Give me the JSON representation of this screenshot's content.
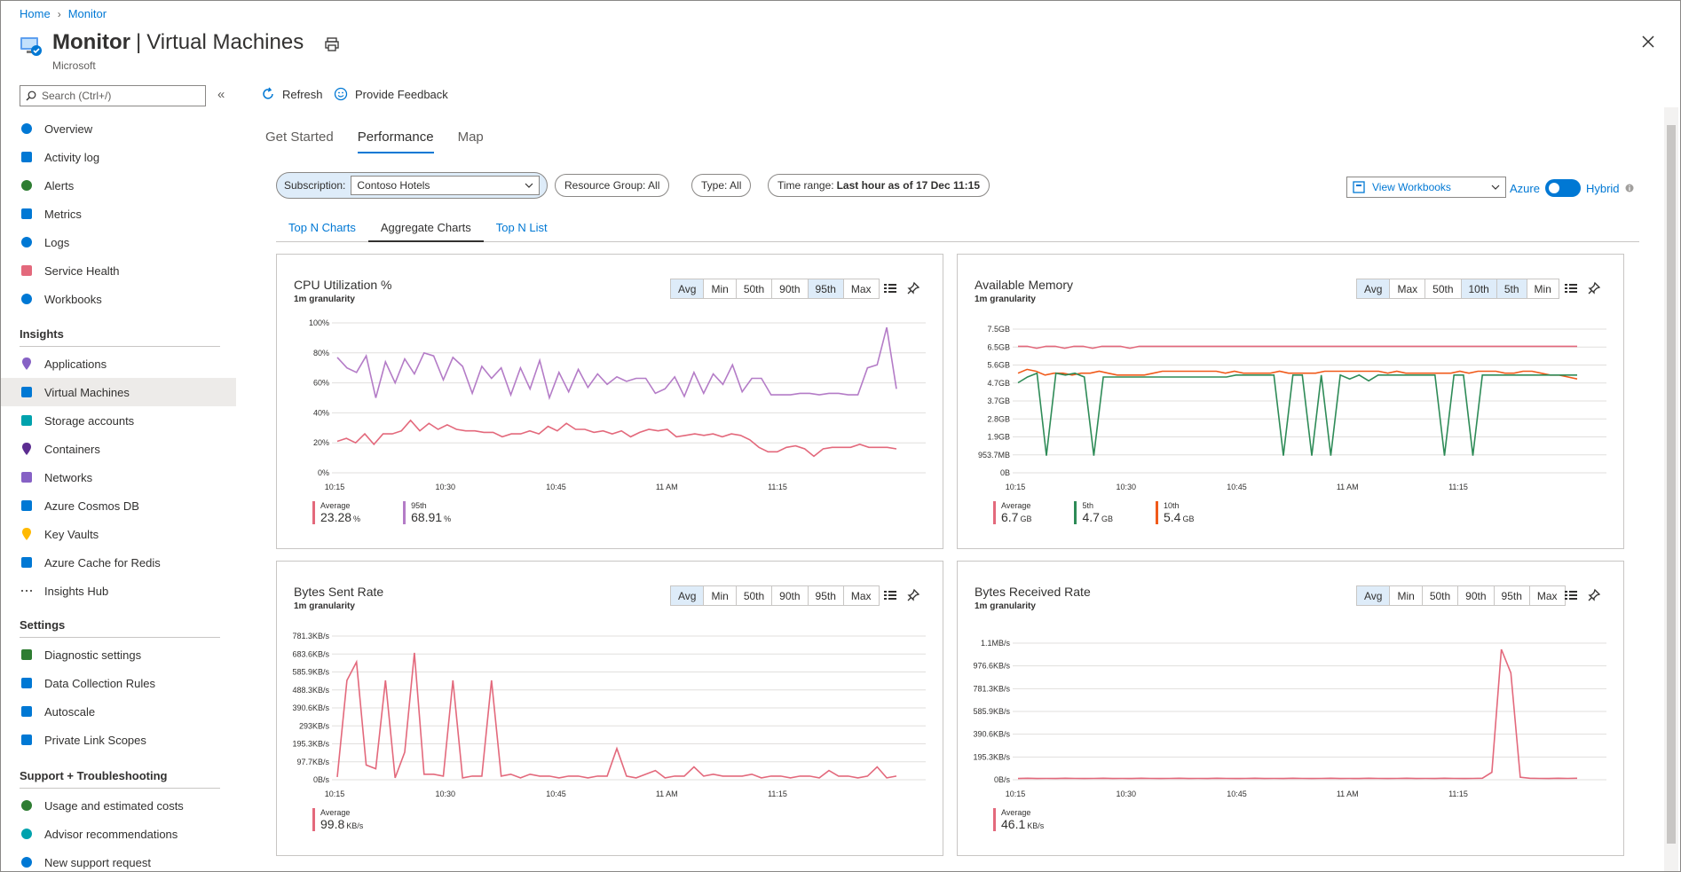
{
  "breadcrumb": [
    "Home",
    "Monitor"
  ],
  "header": {
    "title_bold": "Monitor",
    "title_rest": "Virtual Machines",
    "subtitle": "Microsoft"
  },
  "search": {
    "placeholder": "Search (Ctrl+/)"
  },
  "sidebar": {
    "top_items": [
      "Overview",
      "Activity log",
      "Alerts",
      "Metrics",
      "Logs",
      "Service Health",
      "Workbooks"
    ],
    "insights_header": "Insights",
    "insights_items": [
      "Applications",
      "Virtual Machines",
      "Storage accounts",
      "Containers",
      "Networks",
      "Azure Cosmos DB",
      "Key Vaults",
      "Azure Cache for Redis",
      "Insights Hub"
    ],
    "settings_header": "Settings",
    "settings_items": [
      "Diagnostic settings",
      "Data Collection Rules",
      "Autoscale",
      "Private Link Scopes"
    ],
    "support_header": "Support + Troubleshooting",
    "support_items": [
      "Usage and estimated costs",
      "Advisor recommendations",
      "New support request"
    ]
  },
  "toolbar": {
    "refresh": "Refresh",
    "feedback": "Provide Feedback"
  },
  "tabs": [
    "Get Started",
    "Performance",
    "Map"
  ],
  "filters": {
    "subscription_label": "Subscription:",
    "subscription_value": "Contoso Hotels",
    "resource_group": "Resource Group: All",
    "type": "Type: All",
    "time_range_label": "Time range: ",
    "time_range_value": "Last hour as of 17 Dec 11:15",
    "view_workbooks": "View Workbooks",
    "azure": "Azure",
    "hybrid": "Hybrid"
  },
  "subtabs": [
    "Top N Charts",
    "Aggregate Charts",
    "Top N List"
  ],
  "colors": {
    "accent": "#0078d4",
    "avg": "#e3697c",
    "p95": "#b47cc7",
    "p5": "#2e8b57",
    "p10": "#f05a1a"
  },
  "cards": [
    {
      "title": "CPU Utilization %",
      "granularity": "1m granularity",
      "buttons": [
        "Avg",
        "Min",
        "50th",
        "90th",
        "95th",
        "Max"
      ],
      "selected": [
        "Avg",
        "95th"
      ],
      "legend": [
        {
          "name": "Average",
          "value": "23.28",
          "unit": "%"
        },
        {
          "name": "95th",
          "value": "68.91",
          "unit": "%"
        }
      ]
    },
    {
      "title": "Available Memory",
      "granularity": "1m granularity",
      "buttons": [
        "Avg",
        "Max",
        "50th",
        "10th",
        "5th",
        "Min"
      ],
      "selected": [
        "Avg",
        "10th",
        "5th"
      ],
      "legend": [
        {
          "name": "Average",
          "value": "6.7",
          "unit": "GB"
        },
        {
          "name": "5th",
          "value": "4.7",
          "unit": "GB"
        },
        {
          "name": "10th",
          "value": "5.4",
          "unit": "GB"
        }
      ]
    },
    {
      "title": "Bytes Sent Rate",
      "granularity": "1m granularity",
      "buttons": [
        "Avg",
        "Min",
        "50th",
        "90th",
        "95th",
        "Max"
      ],
      "selected": [
        "Avg"
      ],
      "legend": [
        {
          "name": "Average",
          "value": "99.8",
          "unit": "KB/s"
        }
      ]
    },
    {
      "title": "Bytes Received Rate",
      "granularity": "1m granularity",
      "buttons": [
        "Avg",
        "Min",
        "50th",
        "90th",
        "95th",
        "Max"
      ],
      "selected": [
        "Avg"
      ],
      "legend": [
        {
          "name": "Average",
          "value": "46.1",
          "unit": "KB/s"
        }
      ]
    }
  ],
  "chart_data": [
    {
      "type": "line",
      "title": "CPU Utilization %",
      "x_ticks": [
        "10:15",
        "10:30",
        "10:45",
        "11 AM",
        "11:15"
      ],
      "y_ticks": [
        "100%",
        "80%",
        "60%",
        "40%",
        "20%",
        "0%"
      ],
      "ylim": [
        0,
        100
      ],
      "series": [
        {
          "name": "95th",
          "color": "#b47cc7",
          "values": [
            77,
            70,
            67,
            78,
            50,
            74,
            60,
            76,
            66,
            80,
            78,
            62,
            77,
            71,
            53,
            71,
            63,
            70,
            52,
            70,
            56,
            75,
            50,
            67,
            54,
            69,
            57,
            66,
            59,
            64,
            61,
            63,
            63,
            53,
            56,
            64,
            51,
            67,
            53,
            66,
            59,
            72,
            54,
            63,
            63,
            52,
            52,
            52,
            53,
            53,
            52,
            53,
            53,
            52,
            52,
            70,
            72,
            97,
            56
          ]
        },
        {
          "name": "Average",
          "color": "#e3697c",
          "values": [
            21,
            23,
            20,
            26,
            19,
            26,
            26,
            28,
            35,
            28,
            33,
            29,
            32,
            29,
            28,
            28,
            27,
            27,
            24,
            26,
            26,
            28,
            26,
            31,
            28,
            33,
            29,
            29,
            27,
            28,
            26,
            28,
            24,
            27,
            29,
            28,
            29,
            24,
            25,
            26,
            25,
            26,
            24,
            26,
            25,
            22,
            17,
            14,
            14,
            17,
            18,
            16,
            11,
            16,
            17,
            17,
            17,
            19,
            17,
            17,
            17,
            16
          ]
        }
      ]
    },
    {
      "type": "line",
      "title": "Available Memory",
      "x_ticks": [
        "10:15",
        "10:30",
        "10:45",
        "11 AM",
        "11:15"
      ],
      "y_ticks": [
        "7.5GB",
        "6.5GB",
        "5.6GB",
        "4.7GB",
        "3.7GB",
        "2.8GB",
        "1.9GB",
        "953.7MB",
        "0B"
      ],
      "ylim": [
        0,
        7.5
      ],
      "series": [
        {
          "name": "Average",
          "color": "#e3697c",
          "values": [
            6.6,
            6.6,
            6.5,
            6.6,
            6.6,
            6.5,
            6.6,
            6.6,
            6.5,
            6.6,
            6.6,
            6.6,
            6.5,
            6.6,
            6.6,
            6.6,
            6.6,
            6.6,
            6.6,
            6.6,
            6.6,
            6.6,
            6.6,
            6.6,
            6.6,
            6.6,
            6.6,
            6.6,
            6.6,
            6.6,
            6.6,
            6.6,
            6.6,
            6.6,
            6.6,
            6.6,
            6.6,
            6.6,
            6.6,
            6.6,
            6.6,
            6.6,
            6.6,
            6.6,
            6.6,
            6.6,
            6.6,
            6.6,
            6.6,
            6.6,
            6.6,
            6.6,
            6.6,
            6.6,
            6.6,
            6.6,
            6.6,
            6.6,
            6.6,
            6.6,
            6.6
          ]
        },
        {
          "name": "10th",
          "color": "#f05a1a",
          "values": [
            5.2,
            5.4,
            5.3,
            5.1,
            5.2,
            5.2,
            5.1,
            5.2,
            5.2,
            5.3,
            5.2,
            5.1,
            5.1,
            5.1,
            5.1,
            5.2,
            5.3,
            5.3,
            5.3,
            5.3,
            5.3,
            5.3,
            5.3,
            5.2,
            5.3,
            5.2,
            5.2,
            5.2,
            5.2,
            5.3,
            5.2,
            5.2,
            5.2,
            5.2,
            5.3,
            5.3,
            5.3,
            5.3,
            5.3,
            5.3,
            5.3,
            5.2,
            5.3,
            5.2,
            5.2,
            5.2,
            5.2,
            5.2,
            5.2,
            5.3,
            5.2,
            5.3,
            5.3,
            5.3,
            5.2,
            5.2,
            5.3,
            5.3,
            5.2,
            5.1,
            5.1,
            5.0,
            4.9
          ]
        },
        {
          "name": "5th",
          "color": "#2e8b57",
          "values": [
            4.7,
            5.0,
            5.2,
            0.9,
            5.2,
            5.1,
            5.2,
            5.0,
            0.9,
            5.0,
            5.0,
            5.0,
            5.0,
            5.0,
            5.0,
            5.0,
            5.0,
            5.0,
            5.0,
            5.0,
            5.0,
            5.0,
            5.0,
            5.1,
            5.1,
            5.1,
            5.1,
            5.1,
            0.9,
            5.1,
            5.1,
            0.9,
            5.1,
            0.9,
            5.1,
            4.9,
            5.1,
            4.8,
            5.1,
            5.1,
            5.1,
            5.1,
            5.1,
            5.1,
            5.1,
            0.9,
            5.1,
            5.1,
            0.9,
            5.1,
            5.1,
            5.1,
            5.1,
            5.1,
            5.1,
            5.1,
            5.1,
            5.1,
            5.1,
            5.1
          ]
        }
      ]
    },
    {
      "type": "line",
      "title": "Bytes Sent Rate",
      "x_ticks": [
        "10:15",
        "10:30",
        "10:45",
        "11 AM",
        "11:15"
      ],
      "y_ticks": [
        "781.3KB/s",
        "683.6KB/s",
        "585.9KB/s",
        "488.3KB/s",
        "390.6KB/s",
        "293KB/s",
        "195.3KB/s",
        "97.7KB/s",
        "0B/s"
      ],
      "ylim": [
        0,
        781.3
      ],
      "series": [
        {
          "name": "Average",
          "color": "#e3697c",
          "values": [
            15,
            540,
            640,
            80,
            60,
            540,
            10,
            150,
            690,
            30,
            30,
            20,
            540,
            10,
            20,
            20,
            540,
            20,
            30,
            10,
            30,
            20,
            20,
            10,
            20,
            20,
            10,
            20,
            20,
            170,
            20,
            10,
            30,
            50,
            10,
            20,
            20,
            70,
            20,
            30,
            20,
            20,
            20,
            30,
            10,
            20,
            20,
            10,
            20,
            20,
            10,
            50,
            20,
            20,
            10,
            20,
            70,
            10,
            20
          ]
        }
      ]
    },
    {
      "type": "line",
      "title": "Bytes Received Rate",
      "x_ticks": [
        "10:15",
        "10:30",
        "10:45",
        "11 AM",
        "11:15"
      ],
      "y_ticks": [
        "1.1MB/s",
        "976.6KB/s",
        "781.3KB/s",
        "585.9KB/s",
        "390.6KB/s",
        "195.3KB/s",
        "0B/s"
      ],
      "ylim": [
        0,
        1100
      ],
      "series": [
        {
          "name": "Average",
          "color": "#e3697c",
          "values": [
            10,
            12,
            10,
            11,
            10,
            12,
            11,
            10,
            11,
            12,
            10,
            11,
            10,
            12,
            11,
            10,
            11,
            12,
            10,
            11,
            10,
            12,
            11,
            10,
            11,
            12,
            10,
            11,
            10,
            12,
            11,
            10,
            11,
            12,
            10,
            11,
            10,
            12,
            11,
            10,
            11,
            12,
            10,
            11,
            10,
            12,
            11,
            10,
            11,
            12,
            60,
            1050,
            860,
            20,
            12,
            11,
            10,
            12,
            11,
            12
          ]
        }
      ]
    }
  ]
}
